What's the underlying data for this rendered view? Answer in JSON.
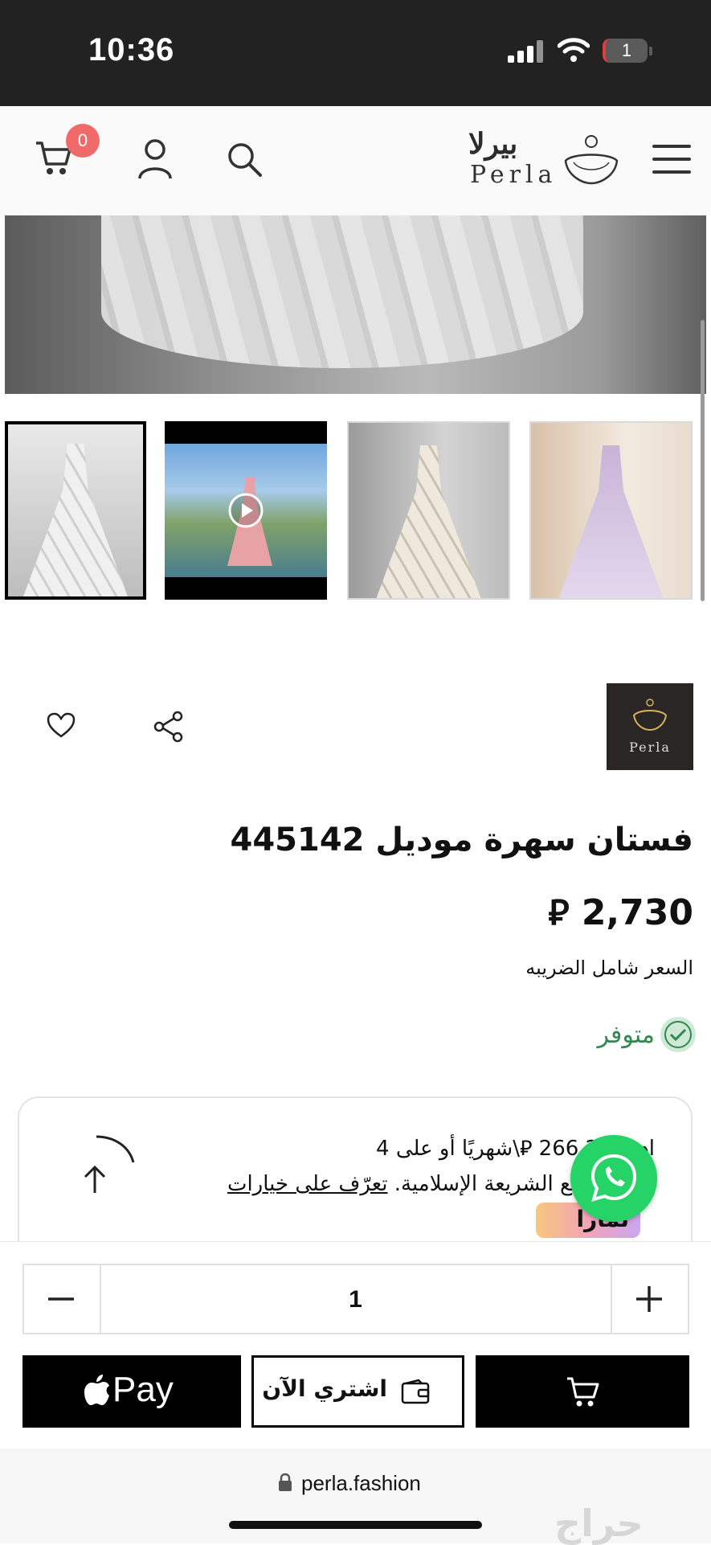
{
  "status_bar": {
    "time": "10:36",
    "battery": "1"
  },
  "header": {
    "cart_count": "0",
    "logo_arabic": "بيرلا",
    "logo_english": "Perla"
  },
  "gallery": {
    "thumbnails": [
      {
        "name": "thumb-silver-gown",
        "selected": true
      },
      {
        "name": "thumb-video",
        "selected": false
      },
      {
        "name": "thumb-champagne-gown",
        "selected": false
      },
      {
        "name": "thumb-lilac-gown",
        "selected": false
      }
    ]
  },
  "brand": {
    "name": "Perla"
  },
  "product": {
    "title": "فستان سهرة موديل 445142",
    "price": "2,730",
    "currency_symbol": "⃁",
    "tax_note": "السعر شامل الضريبه",
    "stock": "متوفر"
  },
  "installments": {
    "line1": "ادفع 266.25 ⃁\\شهريًا أو على 4",
    "line2": "متوافقة مع الشريعة الإسلامية.",
    "link": "تعرّف على خيارات",
    "provider": "تمارا"
  },
  "quantity": {
    "value": "1"
  },
  "actions": {
    "apple_pay": "Pay",
    "buy_now": "اشتري الآن"
  },
  "browser": {
    "url": "perla.fashion"
  },
  "watermark": "حراج",
  "colors": {
    "status_bar": "#222222",
    "badge": "#f16a6a",
    "stock_green": "#2e8a4f",
    "whatsapp": "#25d366"
  }
}
